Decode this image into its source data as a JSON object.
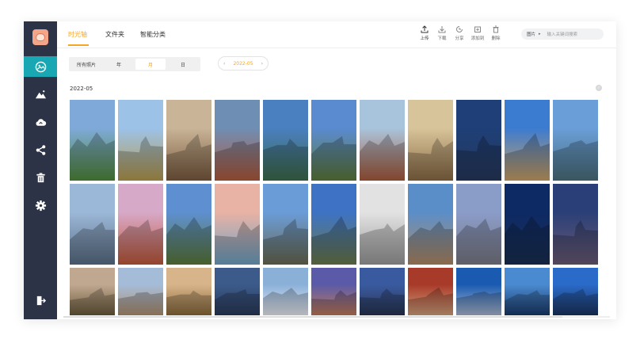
{
  "tabs": [
    {
      "label": "时光轴",
      "active": true
    },
    {
      "label": "文件夹",
      "active": false
    },
    {
      "label": "智能分类",
      "active": false
    }
  ],
  "toolbar": [
    {
      "label": "上传",
      "icon": "upload-icon"
    },
    {
      "label": "下载",
      "icon": "download-icon"
    },
    {
      "label": "分享",
      "icon": "share-icon"
    },
    {
      "label": "添加到",
      "icon": "add-to-icon"
    },
    {
      "label": "删除",
      "icon": "delete-icon"
    }
  ],
  "search": {
    "scope": "图片",
    "caret": "▸",
    "placeholder": "输入关键词搜索"
  },
  "segments": [
    {
      "label": "所有照片",
      "active": false
    },
    {
      "label": "年",
      "active": false
    },
    {
      "label": "月",
      "active": true
    },
    {
      "label": "日",
      "active": false
    }
  ],
  "date": {
    "value": "2022-05",
    "prev": "‹",
    "next": "›"
  },
  "group": {
    "title": "2022-05",
    "check": "✓"
  },
  "sidebar": [
    {
      "icon": "photos-icon",
      "active": true
    },
    {
      "icon": "mountain-icon",
      "active": false
    },
    {
      "icon": "cloud-icon",
      "active": false
    },
    {
      "icon": "share-nodes-icon",
      "active": false
    },
    {
      "icon": "trash-icon",
      "active": false
    },
    {
      "icon": "gear-icon",
      "active": false
    },
    {
      "icon": "logout-icon",
      "active": false
    }
  ],
  "colors": {
    "accent": "#f5a623",
    "sidebar": "#2d3347",
    "active_nav": "#19a8b3"
  },
  "photos": [
    {
      "name": "palace-garden",
      "top": "#7fa9d8",
      "bottom": "#4f8a3a"
    },
    {
      "name": "alpine-village",
      "top": "#9cc2e8",
      "bottom": "#b59a4c"
    },
    {
      "name": "domed-city",
      "top": "#c9b497",
      "bottom": "#7a5a3e"
    },
    {
      "name": "colorful-town",
      "top": "#6f8eb4",
      "bottom": "#b05a3c"
    },
    {
      "name": "waterfall",
      "top": "#4a7fc0",
      "bottom": "#3d6b4a"
    },
    {
      "name": "machu-picchu",
      "top": "#5a8ad0",
      "bottom": "#5b7a3a"
    },
    {
      "name": "balloons-canyon",
      "top": "#a8c4dc",
      "bottom": "#a85a3a"
    },
    {
      "name": "church-interior",
      "top": "#d8c49a",
      "bottom": "#8a6a44"
    },
    {
      "name": "tv-tower-night",
      "top": "#1e3f77",
      "bottom": "#26385c"
    },
    {
      "name": "coastal-town",
      "top": "#3b7bd0",
      "bottom": "#c9a064"
    },
    {
      "name": "pagoda-lake",
      "top": "#6a9ed8",
      "bottom": "#4a6f7c"
    },
    {
      "name": "skyline-reflection",
      "top": "#9cb8d8",
      "bottom": "#5a6e86"
    },
    {
      "name": "hill-church",
      "top": "#d7a9c8",
      "bottom": "#c0583a"
    },
    {
      "name": "castle-garden",
      "top": "#5e8fd0",
      "bottom": "#5a7a3a"
    },
    {
      "name": "ice-sea",
      "top": "#e8b2a4",
      "bottom": "#6ea2c4"
    },
    {
      "name": "cliff-castle",
      "top": "#6a9cd8",
      "bottom": "#6a6a52"
    },
    {
      "name": "cottage-clouds",
      "top": "#3d72c4",
      "bottom": "#6a7a4a"
    },
    {
      "name": "library-curves",
      "top": "#e2e2e2",
      "bottom": "#9a9a9a"
    },
    {
      "name": "drum-tower",
      "top": "#5a8ec8",
      "bottom": "#b08a64"
    },
    {
      "name": "dancing-house",
      "top": "#8a9cc8",
      "bottom": "#7a7a86"
    },
    {
      "name": "night-harbor",
      "top": "#0e2a64",
      "bottom": "#1a2f52"
    },
    {
      "name": "city-lights",
      "top": "#2a3f77",
      "bottom": "#6a5a74"
    },
    {
      "name": "temple-spire",
      "top": "#c0a890",
      "bottom": "#6a5a3a"
    },
    {
      "name": "vatican-dome",
      "top": "#a4bcd8",
      "bottom": "#b09070"
    },
    {
      "name": "sunset-palace",
      "top": "#d8b48a",
      "bottom": "#8a6a3a"
    },
    {
      "name": "dusk-towers",
      "top": "#3c5a8a",
      "bottom": "#2a3a5a"
    },
    {
      "name": "santorini",
      "top": "#8ab0d8",
      "bottom": "#eaeaf0"
    },
    {
      "name": "purple-sky-roof",
      "top": "#5a5aa8",
      "bottom": "#c07a5a"
    },
    {
      "name": "tree-silhouette",
      "top": "#3a5aa0",
      "bottom": "#283450"
    },
    {
      "name": "red-buildings",
      "top": "#a83a2a",
      "bottom": "#d0a07a"
    },
    {
      "name": "snow-mountain",
      "top": "#1a5ab0",
      "bottom": "#a8b8d0"
    },
    {
      "name": "bay-skyline",
      "top": "#4a8ad0",
      "bottom": "#1a3a6a"
    },
    {
      "name": "blue-skyscrapers",
      "top": "#2a6ac8",
      "bottom": "#1a3460"
    }
  ]
}
